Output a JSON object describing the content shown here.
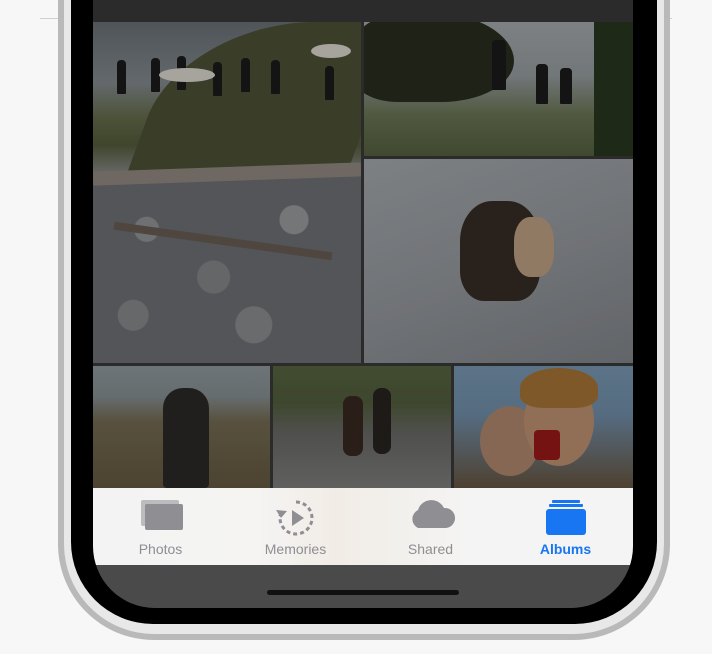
{
  "tab_bar": {
    "active_color": "#1876f2",
    "inactive_color": "#8e8e93",
    "tabs": [
      {
        "label": "Photos",
        "icon": "photos-icon",
        "active": false
      },
      {
        "label": "Memories",
        "icon": "memories-icon",
        "active": false
      },
      {
        "label": "Shared",
        "icon": "cloud-icon",
        "active": false
      },
      {
        "label": "Albums",
        "icon": "albums-icon",
        "active": true
      }
    ]
  }
}
